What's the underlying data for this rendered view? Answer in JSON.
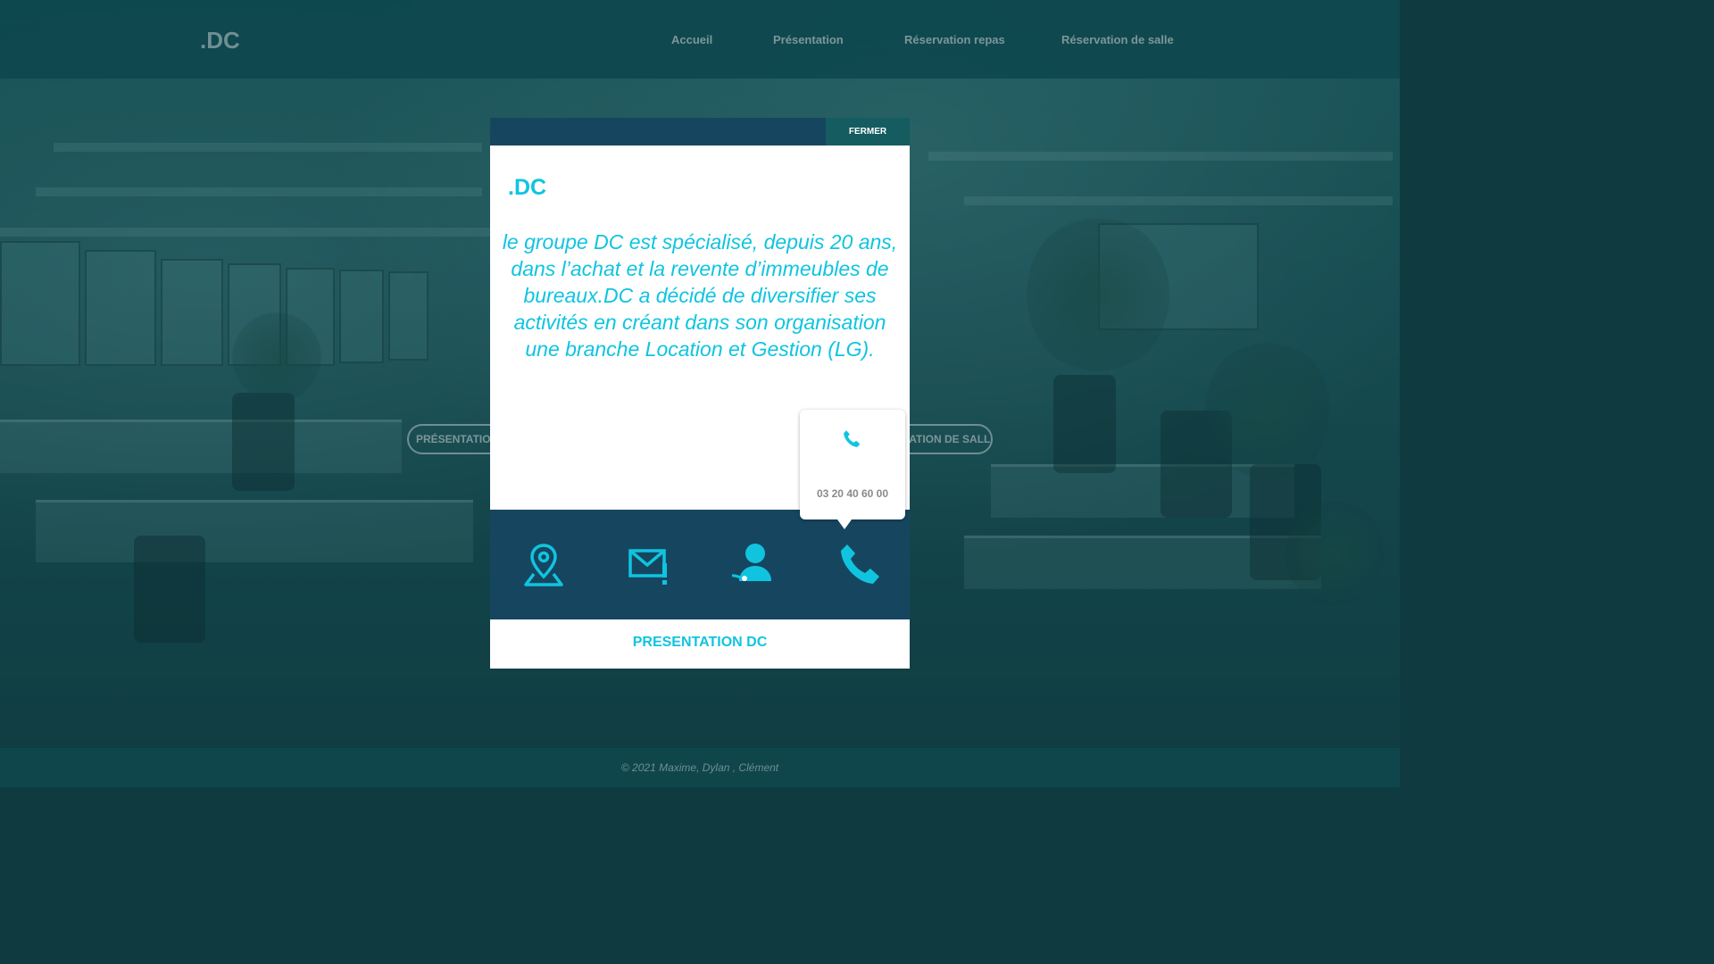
{
  "header": {
    "logo": ".DC",
    "nav": [
      {
        "label": "Accueil"
      },
      {
        "label": "Présentation"
      },
      {
        "label": "Réservation repas"
      },
      {
        "label": "Réservation de salle"
      }
    ]
  },
  "background_buttons": {
    "left_label": "PRÉSENTATION",
    "right_label": "RÉSERVATION DE SALLE"
  },
  "modal": {
    "close_label": "FERMER",
    "brand": ".DC",
    "description": "le groupe DC est spécialisé, depuis 20 ans, dans l’achat et la revente d’immeubles de bureaux.DC a décidé de diversifier ses activités en créant dans son organisation une branche Location et Gestion (LG).",
    "icons": [
      "location-pin-icon",
      "mail-alert-icon",
      "user-support-icon",
      "phone-icon"
    ],
    "footer_title": "PRESENTATION DC",
    "tooltip": {
      "icon": "phone-icon",
      "phone": "03 20 40 60 00"
    }
  },
  "footer": {
    "copyright": "© 2021 Maxime, Dylan , Clément"
  },
  "colors": {
    "accent": "#10c4e0",
    "modal_bar": "#16465f",
    "close_button": "#145c60",
    "header_bg": "#0e484e"
  }
}
